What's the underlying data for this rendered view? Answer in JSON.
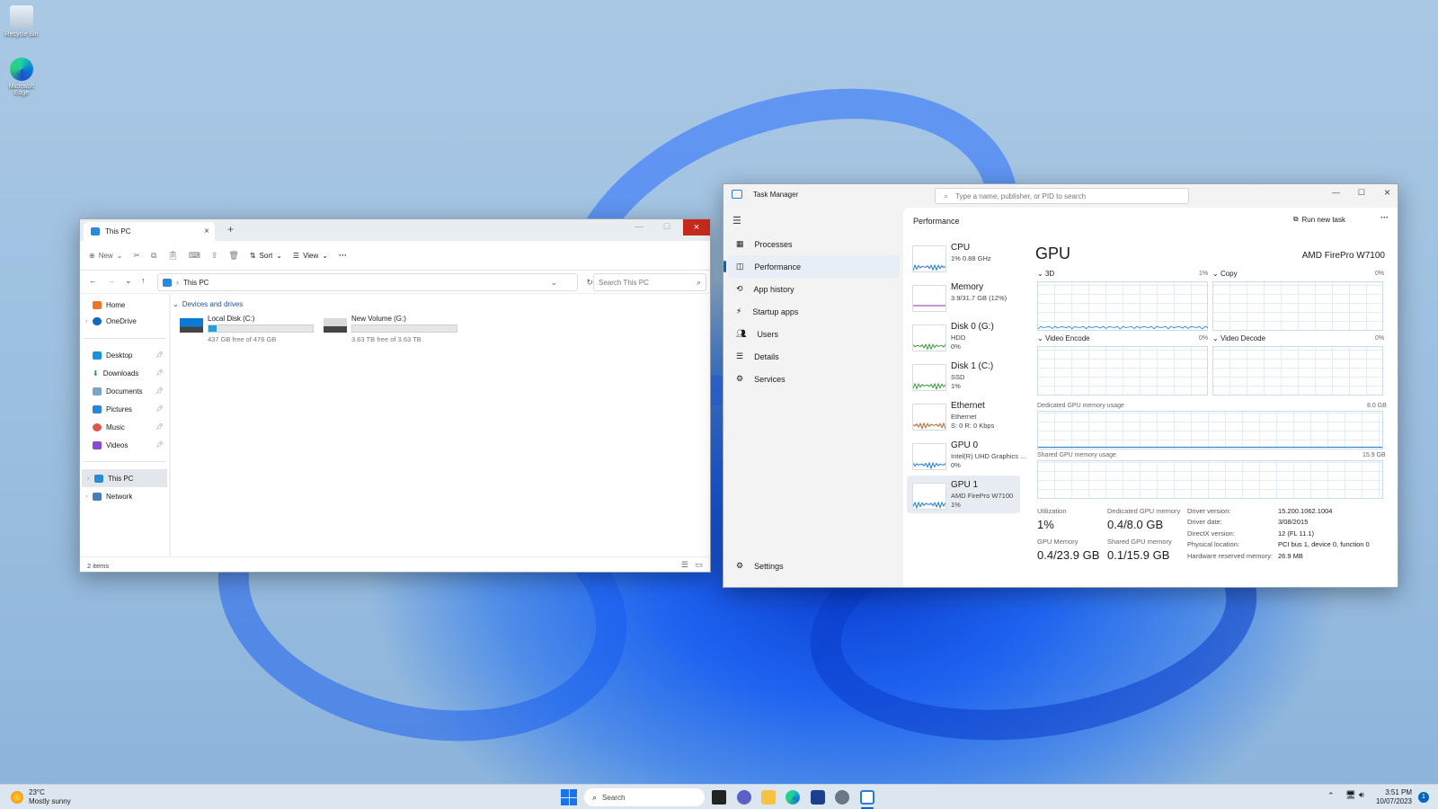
{
  "desktop": {
    "icons": [
      {
        "label": "Recycle Bin"
      },
      {
        "label": "Microsoft Edge"
      }
    ]
  },
  "explorer": {
    "tab_title": "This PC",
    "new_tab": "+",
    "toolbar": {
      "new": "New",
      "sort": "Sort",
      "view": "View",
      "more": "···"
    },
    "address": "This PC",
    "search_placeholder": "Search This PC",
    "nav": {
      "home": "Home",
      "onedrive": "OneDrive",
      "desktop": "Desktop",
      "downloads": "Downloads",
      "documents": "Documents",
      "pictures": "Pictures",
      "music": "Music",
      "videos": "Videos",
      "thispc": "This PC",
      "network": "Network"
    },
    "section": "Devices and drives",
    "drives": [
      {
        "name": "Local Disk (C:)",
        "free": "437 GB free of 476 GB",
        "used_fraction": 0.08
      },
      {
        "name": "New Volume (G:)",
        "free": "3.63 TB free of 3.63 TB",
        "used_fraction": 0.0
      }
    ],
    "status": "2 items"
  },
  "taskmgr": {
    "title": "Task Manager",
    "search_placeholder": "Type a name, publisher, or PID to search",
    "nav": {
      "processes": "Processes",
      "performance": "Performance",
      "app_history": "App history",
      "startup": "Startup apps",
      "users": "Users",
      "details": "Details",
      "services": "Services",
      "settings": "Settings"
    },
    "header": "Performance",
    "run_new_task": "Run new task",
    "devices": [
      {
        "t1": "CPU",
        "t2": "1% 0.88 GHz",
        "t3": "",
        "color": "#1c7cd5"
      },
      {
        "t1": "Memory",
        "t2": "3.9/31.7 GB (12%)",
        "t3": "",
        "color": "#8b2fa8"
      },
      {
        "t1": "Disk 0 (G:)",
        "t2": "HDD",
        "t3": "0%",
        "color": "#3a9a3a"
      },
      {
        "t1": "Disk 1 (C:)",
        "t2": "SSD",
        "t3": "1%",
        "color": "#3a9a3a"
      },
      {
        "t1": "Ethernet",
        "t2": "Ethernet",
        "t3": "S: 0 R: 0 Kbps",
        "color": "#b5652a"
      },
      {
        "t1": "GPU 0",
        "t2": "Intel(R) UHD Graphics ...",
        "t3": "0%",
        "color": "#1c7cd5"
      },
      {
        "t1": "GPU 1",
        "t2": "AMD FirePro W7100",
        "t3": "1%",
        "color": "#1c7cd5"
      }
    ],
    "gpu": {
      "title": "GPU",
      "model": "AMD FirePro W7100",
      "g3d": "3D",
      "g3d_pct": "1%",
      "copy": "Copy",
      "copy_pct": "0%",
      "venc": "Video Encode",
      "venc_pct": "0%",
      "vdec": "Video Decode",
      "vdec_pct": "0%",
      "dedicated_label": "Dedicated GPU memory usage",
      "dedicated_max": "8.0 GB",
      "shared_label": "Shared GPU memory usage",
      "shared_max": "15.9 GB",
      "utilization_label": "Utilization",
      "utilization": "1%",
      "dedicated_mem_label": "Dedicated GPU memory",
      "dedicated_mem": "0.4/8.0 GB",
      "gpu_mem_label": "GPU Memory",
      "gpu_mem": "0.4/23.9 GB",
      "shared_mem_label": "Shared GPU memory",
      "shared_mem": "0.1/15.9 GB",
      "kv": [
        {
          "k": "Driver version:",
          "v": "15.200.1062.1004"
        },
        {
          "k": "Driver date:",
          "v": "3/08/2015"
        },
        {
          "k": "DirectX version:",
          "v": "12 (FL 11.1)"
        },
        {
          "k": "Physical location:",
          "v": "PCI bus 1, device 0, function 0"
        },
        {
          "k": "Hardware reserved memory:",
          "v": "26.9 MB"
        }
      ]
    }
  },
  "taskbar": {
    "weather_temp": "23°C",
    "weather_desc": "Mostly sunny",
    "search": "Search",
    "time": "3:51 PM",
    "date": "10/07/2023",
    "notif": "1",
    "colors": {
      "accent": "#0067c0"
    }
  }
}
